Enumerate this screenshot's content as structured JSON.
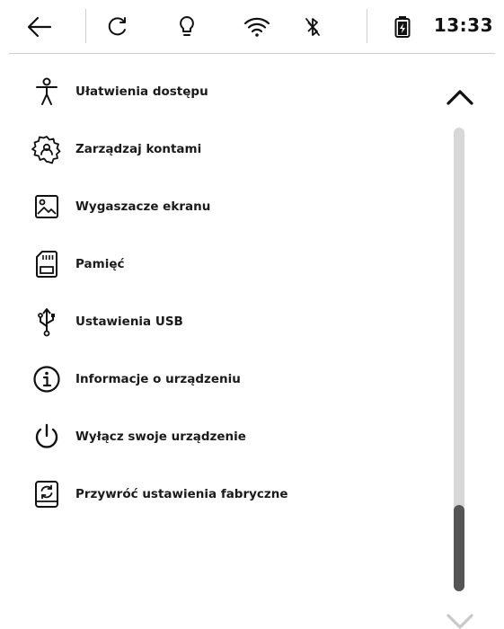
{
  "status_bar": {
    "icons": [
      "back-arrow-icon",
      "refresh-icon",
      "lightbulb-icon",
      "wifi-icon",
      "bluetooth-off-icon",
      "battery-charging-icon"
    ],
    "time": "13:33"
  },
  "menu": {
    "items": [
      {
        "label": "Ułatwienia dostępu",
        "icon": "accessibility-icon"
      },
      {
        "label": "Zarządzaj kontami",
        "icon": "account-gear-icon"
      },
      {
        "label": "Wygaszacze ekranu",
        "icon": "image-icon"
      },
      {
        "label": "Pamięć",
        "icon": "sd-card-icon"
      },
      {
        "label": "Ustawienia USB",
        "icon": "usb-icon"
      },
      {
        "label": "Informacje o urządzeniu",
        "icon": "info-icon"
      },
      {
        "label": "Wyłącz swoje urządzenie",
        "icon": "power-icon"
      },
      {
        "label": "Przywróć ustawienia fabryczne",
        "icon": "factory-reset-icon"
      }
    ]
  },
  "scrollbar": {
    "up_icon": "chevron-up-icon",
    "down_icon": "chevron-down-icon",
    "position": 0.82
  }
}
